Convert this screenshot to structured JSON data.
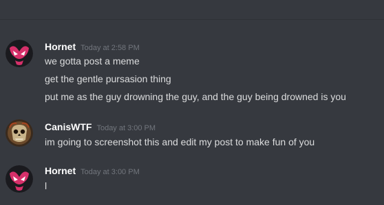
{
  "messages": [
    {
      "user": "Hornet",
      "time": "Today at 2:58 PM",
      "lines": [
        "we gotta post a meme",
        "get the gentle pursasion thing",
        "put me as the guy drowning the guy, and the guy being drowned is you"
      ]
    },
    {
      "user": "CanisWTF",
      "time": "Today at 3:00 PM",
      "lines": [
        "im going to screenshot this and edit my post to make fun of you"
      ]
    },
    {
      "user": "Hornet",
      "time": "Today at 3:00 PM",
      "lines": [
        "l"
      ]
    }
  ],
  "colors": {
    "background": "#36393f",
    "username": "#ffffff",
    "timestamp": "#72767d",
    "message_text": "#dcddde",
    "hornet_avatar_accent": "#d6306a"
  },
  "icons": {
    "hornet_avatar": "hornet-avatar-icon",
    "canis_avatar": "canis-avatar-icon"
  }
}
